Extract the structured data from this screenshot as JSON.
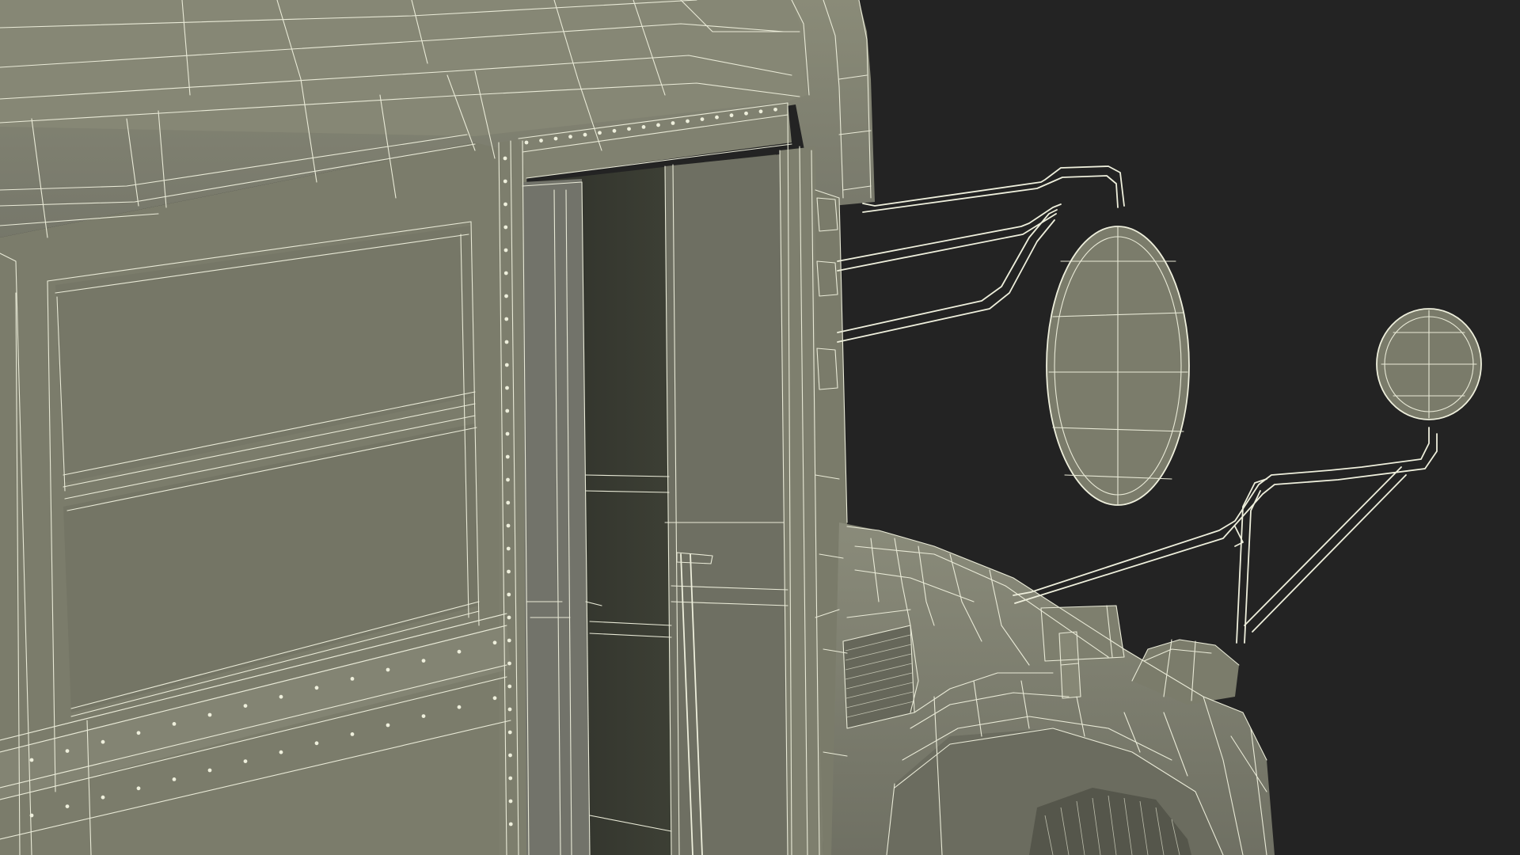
{
  "scene": {
    "background_color": "#232323",
    "surface_color": "#7c7d6c",
    "surface_dark_color": "#5e5f52",
    "doorway_color": "#3b3d33",
    "wire_color": "#e9ead7",
    "render_style": "wireframe-over-shaded"
  }
}
